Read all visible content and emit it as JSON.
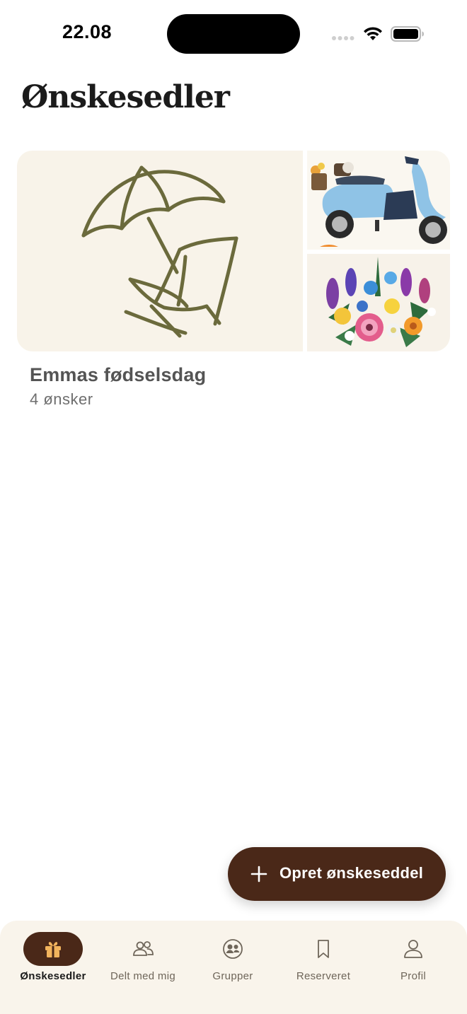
{
  "status_bar": {
    "time": "22.08"
  },
  "header": {
    "title": "Ønskesedler"
  },
  "wishlists": [
    {
      "title": "Emmas fødselsdag",
      "count_label": "4 ønsker",
      "images": [
        "beach-chair-umbrella-illustration",
        "blue-scooter-model",
        "flower-bouquet-model"
      ]
    }
  ],
  "create_button": {
    "label": "Opret ønskeseddel",
    "icon": "plus-icon"
  },
  "tab_bar": {
    "tabs": [
      {
        "label": "Ønskesedler",
        "icon": "gift-icon",
        "active": true
      },
      {
        "label": "Delt med mig",
        "icon": "people-icon",
        "active": false
      },
      {
        "label": "Grupper",
        "icon": "group-icon",
        "active": false
      },
      {
        "label": "Reserveret",
        "icon": "bookmark-icon",
        "active": false
      },
      {
        "label": "Profil",
        "icon": "person-icon",
        "active": false
      }
    ]
  },
  "colors": {
    "brand_dark": "#4a2818",
    "card_bg": "#f8f3e9",
    "illustration": "#6b6a3c",
    "tab_bar_bg": "#f9f4eb",
    "accent_gift": "#f2b45d"
  }
}
